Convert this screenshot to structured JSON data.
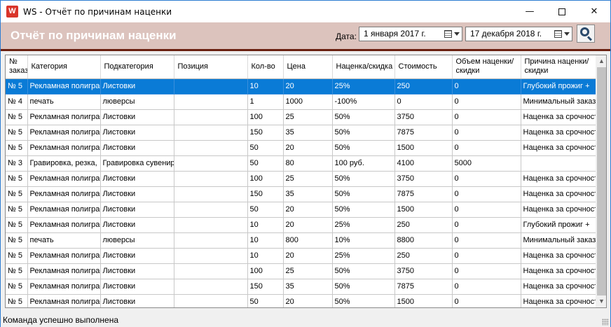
{
  "window": {
    "title": "WS - Отчёт по причинам наценки",
    "app_icon": "W",
    "min_glyph": "—",
    "close_glyph": "✕"
  },
  "header": {
    "title": "Отчёт по причинам наценки",
    "date_label": "Дата:",
    "date_from": "1  января   2017 г.",
    "date_to": "17 декабря  2018 г."
  },
  "table": {
    "columns": [
      "№ заказа",
      "Категория",
      "Подкатегория",
      "Позиция",
      "Кол-во",
      "Цена",
      "Наценка/скидка",
      "Стоимость",
      "Объем наценки/скидки",
      "Причина наценки/скидки"
    ],
    "selected_row": 0,
    "rows": [
      [
        "№ 5",
        "Рекламная полиграфия",
        "Листовки",
        "",
        "10",
        "20",
        "25%",
        "250",
        "0",
        "Глубокий прожиг +"
      ],
      [
        "№ 4",
        "печать",
        "люверсы",
        "",
        "1",
        "1000",
        "-100%",
        "0",
        "0",
        "Минимальный заказ"
      ],
      [
        "№ 5",
        "Рекламная полиграфия",
        "Листовки",
        "",
        "100",
        "25",
        "50%",
        "3750",
        "0",
        "Наценка за срочность"
      ],
      [
        "№ 5",
        "Рекламная полиграфия",
        "Листовки",
        "",
        "150",
        "35",
        "50%",
        "7875",
        "0",
        "Наценка за срочность"
      ],
      [
        "№ 5",
        "Рекламная полиграфия",
        "Листовки",
        "",
        "50",
        "20",
        "50%",
        "1500",
        "0",
        "Наценка за срочность"
      ],
      [
        "№ 3",
        "Гравировка, резка,",
        "Гравировка сувенирной",
        "",
        "50",
        "80",
        "100 руб.",
        "4100",
        "5000",
        ""
      ],
      [
        "№ 5",
        "Рекламная полиграфия",
        "Листовки",
        "",
        "100",
        "25",
        "50%",
        "3750",
        "0",
        "Наценка за срочность"
      ],
      [
        "№ 5",
        "Рекламная полиграфия",
        "Листовки",
        "",
        "150",
        "35",
        "50%",
        "7875",
        "0",
        "Наценка за срочность"
      ],
      [
        "№ 5",
        "Рекламная полиграфия",
        "Листовки",
        "",
        "50",
        "20",
        "50%",
        "1500",
        "0",
        "Наценка за срочность"
      ],
      [
        "№ 5",
        "Рекламная полиграфия",
        "Листовки",
        "",
        "10",
        "20",
        "25%",
        "250",
        "0",
        "Глубокий прожиг +"
      ],
      [
        "№ 5",
        "печать",
        "люверсы",
        "",
        "10",
        "800",
        "10%",
        "8800",
        "0",
        "Минимальный заказ"
      ],
      [
        "№ 5",
        "Рекламная полиграфия",
        "Листовки",
        "",
        "10",
        "20",
        "25%",
        "250",
        "0",
        "Наценка за срочность"
      ],
      [
        "№ 5",
        "Рекламная полиграфия",
        "Листовки",
        "",
        "100",
        "25",
        "50%",
        "3750",
        "0",
        "Наценка за срочность"
      ],
      [
        "№ 5",
        "Рекламная полиграфия",
        "Листовки",
        "",
        "150",
        "35",
        "50%",
        "7875",
        "0",
        "Наценка за срочность"
      ],
      [
        "№ 5",
        "Рекламная полиграфия",
        "Листовки",
        "",
        "50",
        "20",
        "50%",
        "1500",
        "0",
        "Наценка за срочность"
      ]
    ]
  },
  "status": {
    "text": "Команда успешно выполнена"
  },
  "colors": {
    "header_band": "#dcc3bd",
    "header_line": "#6a2010",
    "selection": "#0a7bd6",
    "app_icon": "#d9352a"
  },
  "icons": {
    "app": "app-logo-icon",
    "calendar": "calendar-icon",
    "search": "search-icon",
    "scroll_up": "chevron-up-icon",
    "scroll_down": "chevron-down-icon"
  }
}
